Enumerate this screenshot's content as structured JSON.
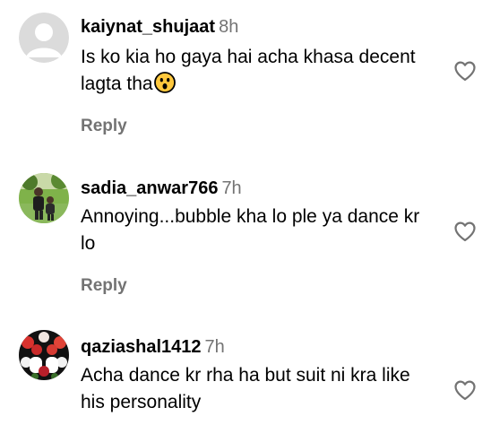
{
  "comments": [
    {
      "username": "kaiynat_shujaat",
      "time": "8h",
      "text": "Is ko kia ho gaya hai acha khasa decent lagta tha",
      "emoji": "astonished-face-emoji",
      "reply_label": "Reply",
      "avatar": "default-avatar-icon",
      "like_icon": "heart-outline-icon"
    },
    {
      "username": "sadia_anwar766",
      "time": "7h",
      "text": "Annoying...bubble kha lo ple ya dance kr lo",
      "reply_label": "Reply",
      "avatar": "photo-avatar",
      "like_icon": "heart-outline-icon"
    },
    {
      "username": "qaziashal1412",
      "time": "7h",
      "text": "Acha dance kr rha ha but suit ni kra like his personality",
      "avatar": "photo-avatar",
      "like_icon": "heart-outline-icon"
    }
  ],
  "colors": {
    "text": "#000000",
    "secondary": "#737373",
    "emoji_fill": "#FFC83D"
  }
}
